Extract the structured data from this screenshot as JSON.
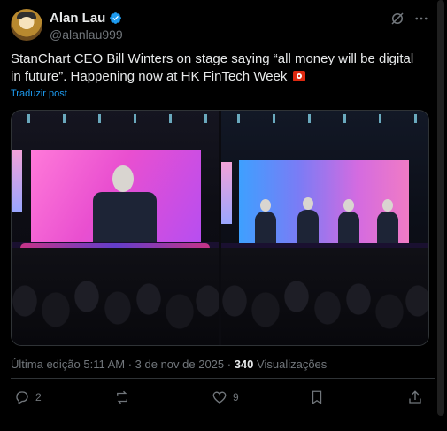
{
  "author": {
    "display_name": "Alan Lau",
    "handle": "@alanlau999",
    "verified": true
  },
  "tweet": {
    "text": "StanChart CEO Bill Winters on stage saying “all money will be digital in future”. Happening now at HK FinTech Week",
    "flag_icon": "hong-kong-flag-icon",
    "translate_label": "Traduzir post"
  },
  "media": {
    "photos": [
      {
        "name": "photo-speaker-closeup"
      },
      {
        "name": "photo-panel-stage"
      }
    ]
  },
  "meta": {
    "edited_label": "Última edição 5:11 AM · 3 de nov de 2025 ·",
    "views_count": "340",
    "views_label": "Visualizações"
  },
  "actions": {
    "reply_count": "2",
    "repost_count": "",
    "like_count": "9"
  },
  "colors": {
    "background": "#000000",
    "text_primary": "#e7e9ea",
    "text_secondary": "#71767b",
    "accent": "#1d9bf0",
    "divider": "#2f3336"
  }
}
